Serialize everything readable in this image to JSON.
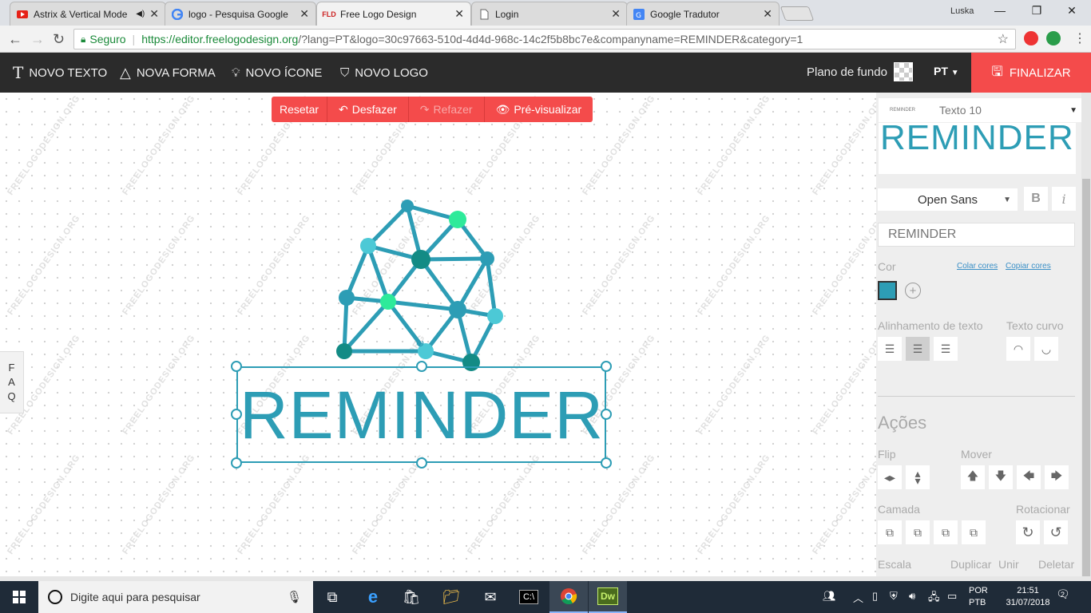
{
  "browser": {
    "tabs": [
      {
        "title": "Astrix & Vertical Mode",
        "favicon": "youtube-icon"
      },
      {
        "title": "logo - Pesquisa Google",
        "favicon": "google-icon"
      },
      {
        "title": "Free Logo Design",
        "favicon": "fld-icon",
        "favicon_text": "FLD"
      },
      {
        "title": "Login",
        "favicon": "page-icon"
      },
      {
        "title": "Google Tradutor",
        "favicon": "translate-icon"
      }
    ],
    "user": "Luska",
    "secure_label": "Seguro",
    "url_host": "https://editor.freelogodesign.org",
    "url_path": "/?lang=PT&logo=30c97663-510d-4d4d-968c-14c2f5b8bc7e&companyname=REMINDER&category=1"
  },
  "appbar": {
    "novo_texto": "NOVO TEXTO",
    "nova_forma": "NOVA FORMA",
    "novo_icone": "NOVO ÍCONE",
    "novo_logo": "NOVO LOGO",
    "plano_de_fundo": "Plano de fundo",
    "lang": "PT",
    "finalizar": "FINALIZAR"
  },
  "editbar": {
    "resetar": "Resetar",
    "desfazer": "Desfazer",
    "refazer": "Refazer",
    "previsualizar": "Pré-visualizar"
  },
  "canvas": {
    "watermark": "FREELOGODESIGN.ORG",
    "faq": [
      "F",
      "A",
      "Q"
    ],
    "logo_text": "REMINDER"
  },
  "panel": {
    "layer_thumb": "REMINDER",
    "layer_name": "Texto 10",
    "preview_text": "REMINDER",
    "font": "Open Sans",
    "bold": "B",
    "italic": "i",
    "text_value": "REMINDER",
    "cor": "Cor",
    "colar_cores": "Colar cores",
    "copiar_cores": "Copiar cores",
    "color": "#2d9db5",
    "alinhamento": "Alinhamento de texto",
    "texto_curvo": "Texto curvo",
    "acoes": "Ações",
    "flip": "Flip",
    "mover": "Mover",
    "camada": "Camada",
    "rotacionar": "Rotacionar",
    "escala": "Escala",
    "duplicar": "Duplicar",
    "unir": "Unir",
    "deletar": "Deletar"
  },
  "taskbar": {
    "search_placeholder": "Digite aqui para pesquisar",
    "lang_line1": "POR",
    "lang_line2": "PTB",
    "time": "21:51",
    "date": "31/07/2018",
    "notifications": "2"
  },
  "colors": {
    "accent": "#f44b4b",
    "logo": "#2d9db5",
    "node_dark": "#138b85",
    "node_light": "#4cc9d6",
    "node_green": "#2eea9a"
  }
}
